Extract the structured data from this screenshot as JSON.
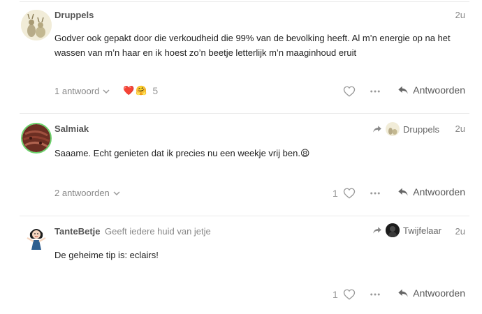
{
  "posts": [
    {
      "username": "Druppels",
      "user_title": "",
      "date": "2u",
      "body": "Godver ook gepakt door die verkoudheid die 99% van de bevolking heeft. Al m’n energie op na het wassen van m’n haar en ik hoest zo’n beetje letterlijk m’n maaginhoud eruit",
      "replies_label": "1 antwoord",
      "reactions": [
        "❤️",
        "🤗"
      ],
      "reaction_count": "5",
      "like_count": "",
      "reply_label": "Antwoorden"
    },
    {
      "username": "Salmiak",
      "user_title": "",
      "date": "2u",
      "reply_to_user": "Druppels",
      "body": "Saaame. Echt genieten dat ik precies nu een weekje vrij ben.😫",
      "replies_label": "2 antwoorden",
      "like_count": "1",
      "reply_label": "Antwoorden"
    },
    {
      "username": "TanteBetje",
      "user_title": "Geeft iedere huid van jetje",
      "date": "2u",
      "reply_to_user": "Twijfelaar",
      "body": "De geheime tip is: eclairs!",
      "like_count": "1",
      "reply_label": "Antwoorden"
    }
  ],
  "colors": {
    "text": "#222222",
    "muted": "#888888",
    "divider": "#e9e9e9",
    "salmiak_ring": "#6ad26a",
    "heart": "#e0245e"
  },
  "icons": {
    "like": "heart-outline-icon",
    "more": "ellipsis-icon",
    "reply": "reply-arrow-icon",
    "share": "share-arrow-icon",
    "chevron": "chevron-down-icon"
  }
}
